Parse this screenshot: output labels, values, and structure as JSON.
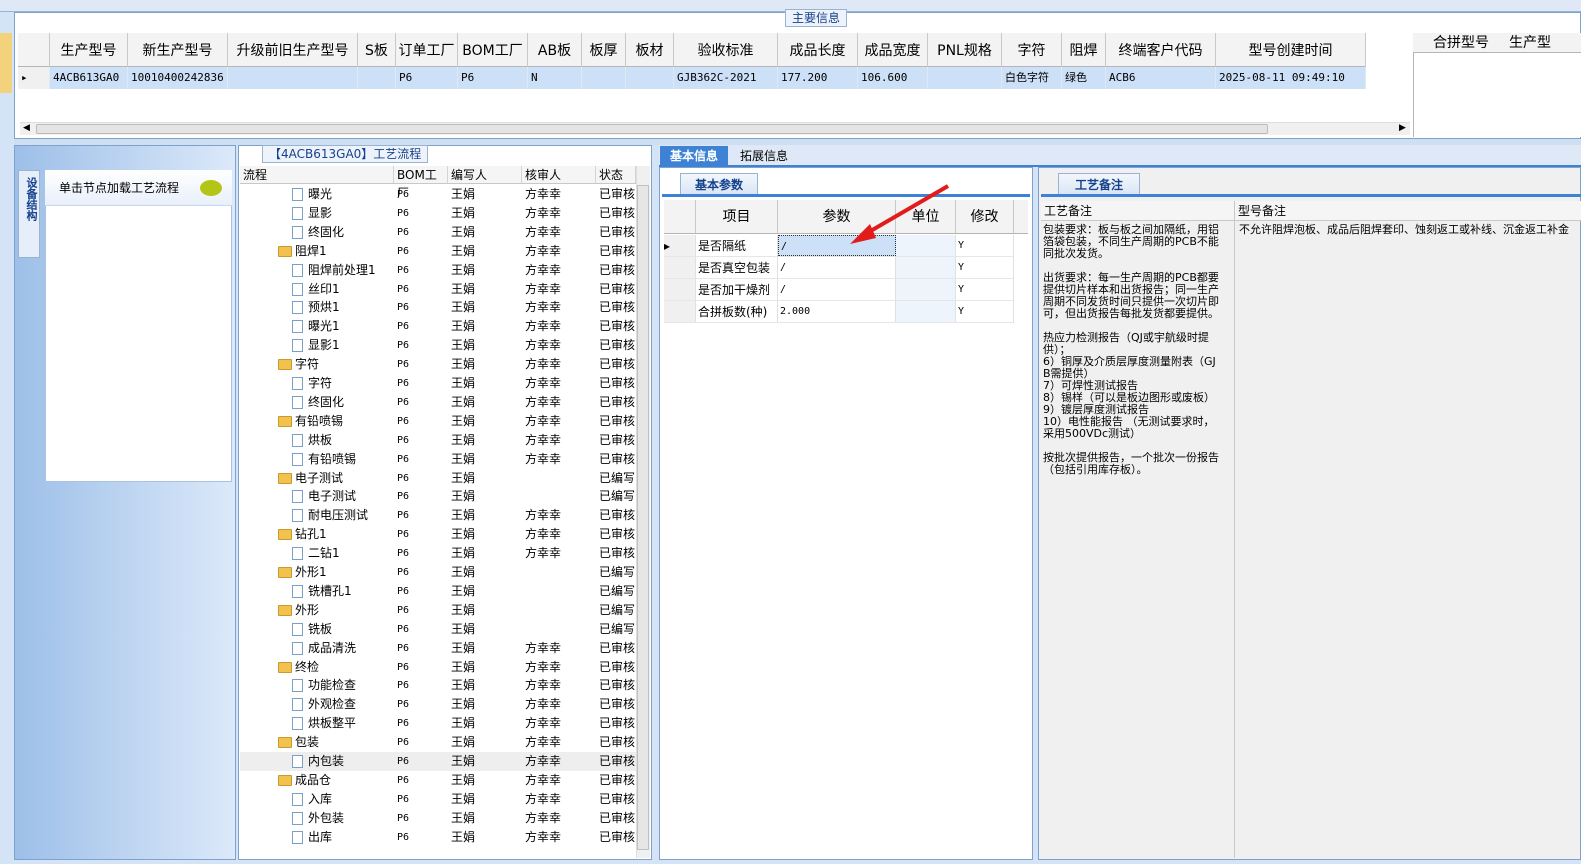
{
  "main": {
    "title": "主要信息",
    "columns": [
      "生产型号",
      "新生产型号",
      "升级前旧生产型号",
      "S板",
      "订单工厂",
      "BOM工厂",
      "AB板",
      "板厚",
      "板材",
      "验收标准",
      "成品长度",
      "成品宽度",
      "PNL规格",
      "字符",
      "阻焊",
      "终端客户代码",
      "型号创建时间"
    ],
    "row": [
      "4ACB613GA0",
      "10010400242836",
      "",
      "",
      "P6",
      "P6",
      "N",
      "",
      "",
      "GJB362C-2021",
      "177.200",
      "106.600",
      "",
      "白色字符",
      "绿色",
      "ACB6",
      "2025-08-11 09:49:10"
    ],
    "pin_columns": [
      "合拼型号",
      "生产型"
    ]
  },
  "nav": {
    "tab_label": "设备结构",
    "card_title": "单击节点加载工艺流程"
  },
  "tree": {
    "title": "【4ACB613GA0】工艺流程",
    "columns": [
      "流程",
      "BOM工厂",
      "编写人",
      "核审人",
      "状态"
    ],
    "rows": [
      {
        "name": "曝光",
        "type": "doc",
        "bom": "P6",
        "author": "王娟",
        "reviewer": "方幸幸",
        "status": "已审核"
      },
      {
        "name": "显影",
        "type": "doc",
        "bom": "P6",
        "author": "王娟",
        "reviewer": "方幸幸",
        "status": "已审核"
      },
      {
        "name": "终固化",
        "type": "doc",
        "bom": "P6",
        "author": "王娟",
        "reviewer": "方幸幸",
        "status": "已审核"
      },
      {
        "name": "阻焊1",
        "type": "folder",
        "bom": "P6",
        "author": "王娟",
        "reviewer": "方幸幸",
        "status": "已审核"
      },
      {
        "name": "阻焊前处理1",
        "type": "doc",
        "bom": "P6",
        "author": "王娟",
        "reviewer": "方幸幸",
        "status": "已审核"
      },
      {
        "name": "丝印1",
        "type": "doc",
        "bom": "P6",
        "author": "王娟",
        "reviewer": "方幸幸",
        "status": "已审核"
      },
      {
        "name": "预烘1",
        "type": "doc",
        "bom": "P6",
        "author": "王娟",
        "reviewer": "方幸幸",
        "status": "已审核"
      },
      {
        "name": "曝光1",
        "type": "doc",
        "bom": "P6",
        "author": "王娟",
        "reviewer": "方幸幸",
        "status": "已审核"
      },
      {
        "name": "显影1",
        "type": "doc",
        "bom": "P6",
        "author": "王娟",
        "reviewer": "方幸幸",
        "status": "已审核"
      },
      {
        "name": "字符",
        "type": "folder",
        "bom": "P6",
        "author": "王娟",
        "reviewer": "方幸幸",
        "status": "已审核"
      },
      {
        "name": "字符",
        "type": "doc",
        "bom": "P6",
        "author": "王娟",
        "reviewer": "方幸幸",
        "status": "已审核"
      },
      {
        "name": "终固化",
        "type": "doc",
        "bom": "P6",
        "author": "王娟",
        "reviewer": "方幸幸",
        "status": "已审核"
      },
      {
        "name": "有铅喷锡",
        "type": "folder",
        "bom": "P6",
        "author": "王娟",
        "reviewer": "方幸幸",
        "status": "已审核"
      },
      {
        "name": "烘板",
        "type": "doc",
        "bom": "P6",
        "author": "王娟",
        "reviewer": "方幸幸",
        "status": "已审核"
      },
      {
        "name": "有铅喷锡",
        "type": "doc",
        "bom": "P6",
        "author": "王娟",
        "reviewer": "方幸幸",
        "status": "已审核"
      },
      {
        "name": "电子测试",
        "type": "folder",
        "bom": "P6",
        "author": "王娟",
        "reviewer": "",
        "status": "已编写"
      },
      {
        "name": "电子测试",
        "type": "doc",
        "bom": "P6",
        "author": "王娟",
        "reviewer": "",
        "status": "已编写"
      },
      {
        "name": "耐电压测试",
        "type": "doc",
        "bom": "P6",
        "author": "王娟",
        "reviewer": "方幸幸",
        "status": "已审核"
      },
      {
        "name": "钻孔1",
        "type": "folder",
        "bom": "P6",
        "author": "王娟",
        "reviewer": "方幸幸",
        "status": "已审核"
      },
      {
        "name": "二钻1",
        "type": "doc",
        "bom": "P6",
        "author": "王娟",
        "reviewer": "方幸幸",
        "status": "已审核"
      },
      {
        "name": "外形1",
        "type": "folder",
        "bom": "P6",
        "author": "王娟",
        "reviewer": "",
        "status": "已编写"
      },
      {
        "name": "铣槽孔1",
        "type": "doc",
        "bom": "P6",
        "author": "王娟",
        "reviewer": "",
        "status": "已编写"
      },
      {
        "name": "外形",
        "type": "folder",
        "bom": "P6",
        "author": "王娟",
        "reviewer": "",
        "status": "已编写"
      },
      {
        "name": "铣板",
        "type": "doc",
        "bom": "P6",
        "author": "王娟",
        "reviewer": "",
        "status": "已编写"
      },
      {
        "name": "成品清洗",
        "type": "doc",
        "bom": "P6",
        "author": "王娟",
        "reviewer": "方幸幸",
        "status": "已审核"
      },
      {
        "name": "终检",
        "type": "folder",
        "bom": "P6",
        "author": "王娟",
        "reviewer": "方幸幸",
        "status": "已审核"
      },
      {
        "name": "功能检查",
        "type": "doc",
        "bom": "P6",
        "author": "王娟",
        "reviewer": "方幸幸",
        "status": "已审核"
      },
      {
        "name": "外观检查",
        "type": "doc",
        "bom": "P6",
        "author": "王娟",
        "reviewer": "方幸幸",
        "status": "已审核"
      },
      {
        "name": "烘板整平",
        "type": "doc",
        "bom": "P6",
        "author": "王娟",
        "reviewer": "方幸幸",
        "status": "已审核"
      },
      {
        "name": "包装",
        "type": "folder",
        "bom": "P6",
        "author": "王娟",
        "reviewer": "方幸幸",
        "status": "已审核"
      },
      {
        "name": "内包装",
        "type": "doc",
        "bom": "P6",
        "author": "王娟",
        "reviewer": "方幸幸",
        "status": "已审核",
        "selected": true
      },
      {
        "name": "成品仓",
        "type": "folder",
        "bom": "P6",
        "author": "王娟",
        "reviewer": "方幸幸",
        "status": "已审核"
      },
      {
        "name": "入库",
        "type": "doc",
        "bom": "P6",
        "author": "王娟",
        "reviewer": "方幸幸",
        "status": "已审核"
      },
      {
        "name": "外包装",
        "type": "doc",
        "bom": "P6",
        "author": "王娟",
        "reviewer": "方幸幸",
        "status": "已审核"
      },
      {
        "name": "出库",
        "type": "doc",
        "bom": "P6",
        "author": "王娟",
        "reviewer": "方幸幸",
        "status": "已审核"
      }
    ]
  },
  "tabs": {
    "basic": "基本信息",
    "extended": "拓展信息"
  },
  "params": {
    "tab_label": "基本参数",
    "columns": [
      "项目",
      "参数",
      "单位",
      "修改"
    ],
    "rows": [
      {
        "item": "是否隔纸",
        "value": "/",
        "unit": "",
        "edit": "Y"
      },
      {
        "item": "是否真空包装",
        "value": "/",
        "unit": "",
        "edit": "Y"
      },
      {
        "item": "是否加干燥剂",
        "value": "/",
        "unit": "",
        "edit": "Y"
      },
      {
        "item": "合拼板数(种)",
        "value": "2.000",
        "unit": "",
        "edit": "Y"
      }
    ]
  },
  "notes": {
    "tab_label": "工艺备注",
    "col1": "工艺备注",
    "col2": "型号备注",
    "process_note": "包装要求：板与板之间加隔纸，用铝箔袋包装，不同生产周期的PCB不能同批次发货。\n\n出货要求：每一生产周期的PCB都要提供切片样本和出货报告；同一生产周期不同发货时间只提供一次切片即可，但出货报告每批发货都要提供。\n\n热应力检测报告（QJ或宇航级时提供）；\n6）铜厚及介质层厚度测量附表（GJB需提供）\n7）可焊性测试报告\n8）锡样（可以是板边图形或废板）\n9）镀层厚度测试报告\n10）电性能报告 （无测试要求时，采用500VDc测试）\n\n按批次提供报告，一个批次一份报告（包括引用库存板）。",
    "model_note": "不允许阻焊泡板、成品后阻焊套印、蚀刻返工或补线、沉金返工补金"
  }
}
